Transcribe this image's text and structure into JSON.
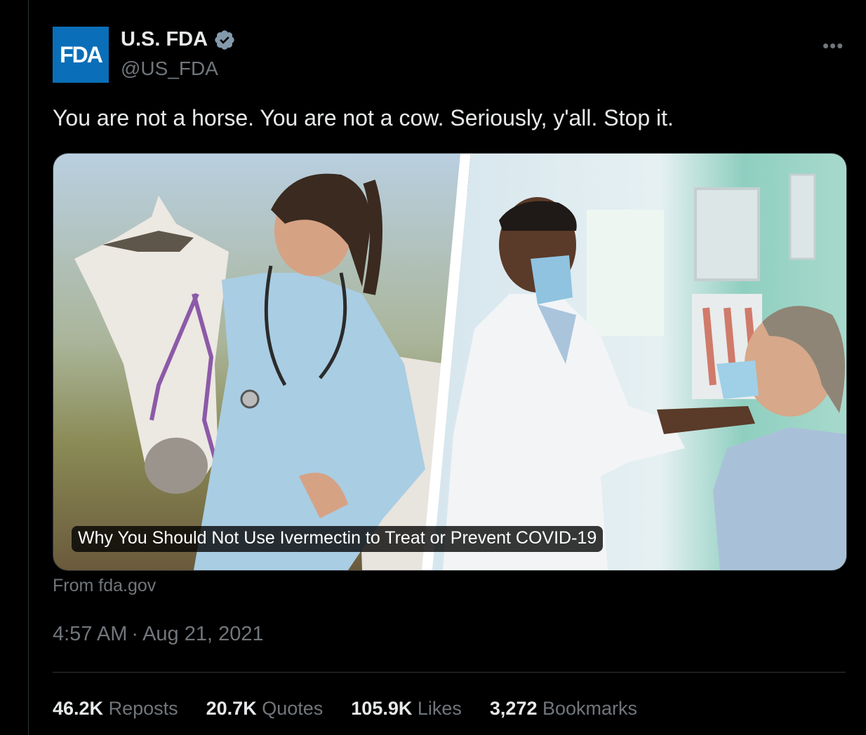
{
  "account": {
    "avatar_text": "FDA",
    "avatar_color": "#0a6fb8",
    "display_name": "U.S. FDA",
    "verified_icon": "verified-badge-icon",
    "handle": "@US_FDA"
  },
  "menu": {
    "more_label": "•••"
  },
  "tweet": {
    "text": "You are not a horse. You are not a cow. Seriously, y'all. Stop it."
  },
  "card": {
    "title": "Why You Should Not Use Ivermectin to Treat or Prevent COVID-19",
    "source": "From fda.gov"
  },
  "meta": {
    "time": "4:57 AM",
    "separator": "·",
    "date": "Aug 21, 2021"
  },
  "stats": [
    {
      "count": "46.2K",
      "label": "Reposts"
    },
    {
      "count": "20.7K",
      "label": "Quotes"
    },
    {
      "count": "105.9K",
      "label": "Likes"
    },
    {
      "count": "3,272",
      "label": "Bookmarks"
    }
  ],
  "colors": {
    "background": "#000000",
    "text": "#e7e9ea",
    "muted": "#71767b",
    "verified": "#829aab"
  }
}
